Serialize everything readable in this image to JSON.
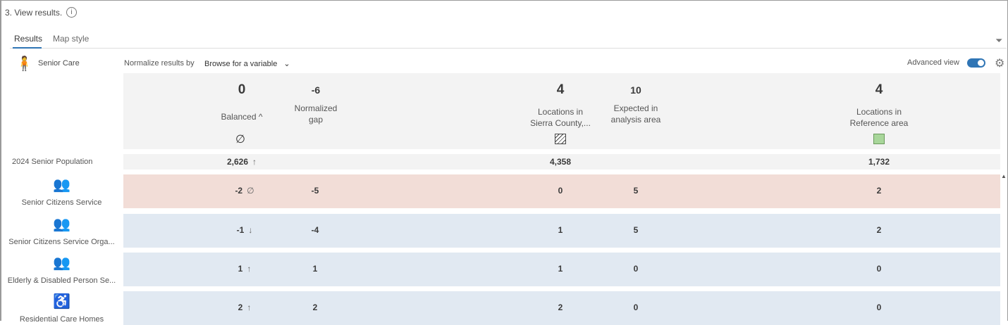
{
  "step": {
    "label": "3.  View results."
  },
  "tabs": [
    {
      "label": "Results"
    },
    {
      "label": "Map style"
    }
  ],
  "category": {
    "label": "Senior Care"
  },
  "normalize": {
    "label": "Normalize results by",
    "value": "Browse for a variable"
  },
  "advanced": {
    "label": "Advanced view",
    "enabled": true
  },
  "header": {
    "balanced": {
      "value": "0",
      "label": "Balanced"
    },
    "gap": {
      "value": "-6",
      "label1": "Normalized",
      "label2": "gap"
    },
    "locations": {
      "value": "4",
      "label1": "Locations in",
      "label2": "Sierra County,..."
    },
    "expected": {
      "value": "10",
      "label1": "Expected in",
      "label2": "analysis area"
    },
    "reference": {
      "value": "4",
      "label1": "Locations in",
      "label2": "Reference area"
    }
  },
  "population": {
    "label": "2024 Senior Population",
    "balanced": "2,626",
    "locations": "4,358",
    "reference": "1,732"
  },
  "rows": [
    {
      "label": "Senior Citizens Service",
      "balanced": "-2",
      "status": "∅",
      "gap": "-5",
      "locations": "0",
      "expected": "5",
      "reference": "2"
    },
    {
      "label": "Senior Citizens Service Orga...",
      "balanced": "-1",
      "status": "↓",
      "gap": "-4",
      "locations": "1",
      "expected": "5",
      "reference": "2"
    },
    {
      "label": "Elderly & Disabled Person Se...",
      "balanced": "1",
      "status": "↑",
      "gap": "1",
      "locations": "1",
      "expected": "0",
      "reference": "0"
    },
    {
      "label": "Residential Care Homes",
      "balanced": "2",
      "status": "↑",
      "gap": "2",
      "locations": "2",
      "expected": "0",
      "reference": "0"
    }
  ],
  "colors": {
    "deficit": "#f2ddd7",
    "surplus": "#e1e9f2",
    "accent": "#2f75b5",
    "reference": "#a8d69a"
  }
}
